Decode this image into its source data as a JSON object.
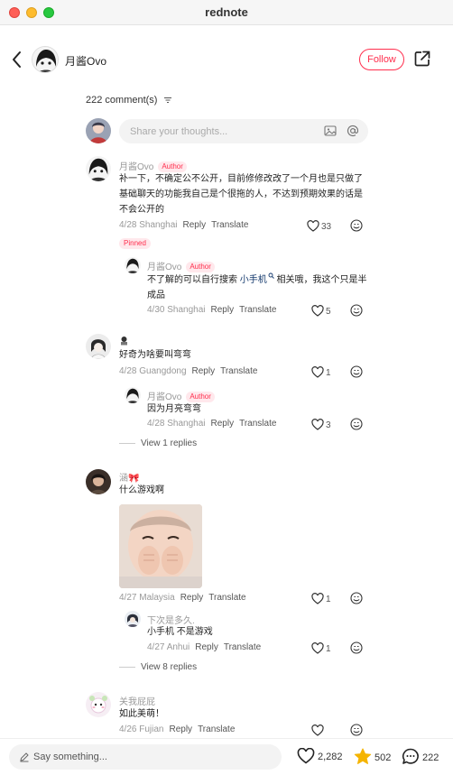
{
  "window": {
    "title": "rednote"
  },
  "header": {
    "author_name": "月酱Ovo",
    "follow_label": "Follow"
  },
  "comments_header": {
    "count_label": "222 comment(s)"
  },
  "composer": {
    "placeholder": "Share your thoughts..."
  },
  "comments": [
    {
      "name": "月酱Ovo",
      "badge": "Author",
      "text": "补一下，不确定公不公开，目前修修改改了一个月也是只做了基础聊天的功能我自己是个很拖的人，不达到预期效果的话是不会公开的",
      "date": "4/28 Shanghai",
      "reply": "Reply",
      "translate": "Translate",
      "likes": "33",
      "pinned": "Pinned",
      "replies": [
        {
          "name": "月酱Ovo",
          "badge": "Author",
          "text_before": "不了解的可以自行搜索 ",
          "text_link": "小手机",
          "text_after": " 相关哦，我这个只是半成品",
          "date": "4/30 Shanghai",
          "reply": "Reply",
          "translate": "Translate",
          "likes": "5"
        }
      ]
    },
    {
      "name": "",
      "text": "好奇为啥要叫弯弯",
      "date": "4/28 Guangdong",
      "reply": "Reply",
      "translate": "Translate",
      "likes": "1",
      "replies": [
        {
          "name": "月酱Ovo",
          "badge": "Author",
          "text": "因为月亮弯弯",
          "date": "4/28 Shanghai",
          "reply": "Reply",
          "translate": "Translate",
          "likes": "3"
        }
      ],
      "view_replies": "View 1 replies"
    },
    {
      "name": "涵🎀",
      "text": "什么游戏啊",
      "date": "4/27 Malaysia",
      "reply": "Reply",
      "translate": "Translate",
      "likes": "1",
      "replies": [
        {
          "name": "下次是多久.",
          "text": "小手机 不是游戏",
          "date": "4/27 Anhui",
          "reply": "Reply",
          "translate": "Translate",
          "likes": "1"
        }
      ],
      "view_replies": "View 8 replies"
    },
    {
      "name": "关我屁屁",
      "text": "如此美萌！",
      "date": "4/26 Fujian",
      "reply": "Reply",
      "translate": "Translate"
    }
  ],
  "bottom_bar": {
    "say_placeholder": "Say something...",
    "likes": "2,282",
    "collects": "502",
    "comments": "222"
  },
  "colors": {
    "accent": "#ff2e4d",
    "collect_star": "#f5b400"
  }
}
